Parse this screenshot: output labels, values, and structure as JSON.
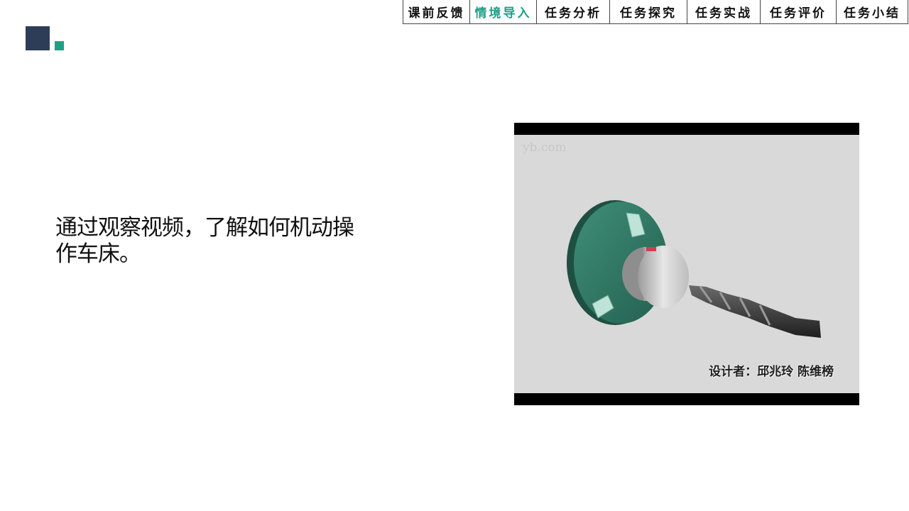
{
  "nav": {
    "tabs": [
      {
        "label": "课前反馈",
        "active": false
      },
      {
        "label": "情境导入",
        "active": true
      },
      {
        "label": "任务分析",
        "active": false
      },
      {
        "label": "任务探究",
        "active": false
      },
      {
        "label": "任务实战",
        "active": false
      },
      {
        "label": "任务评价",
        "active": false
      },
      {
        "label": "任务小结",
        "active": false
      }
    ]
  },
  "content": {
    "description": "通过观察视频，了解如何机动操作车床。"
  },
  "video": {
    "watermark": "yb.com",
    "credit": "设计者：邱兆玲  陈维榜"
  },
  "colors": {
    "accent": "#1f9f86",
    "dark_square": "#2e3d57",
    "chuck": "#2f7a66",
    "video_bg": "#d9d9d9"
  }
}
